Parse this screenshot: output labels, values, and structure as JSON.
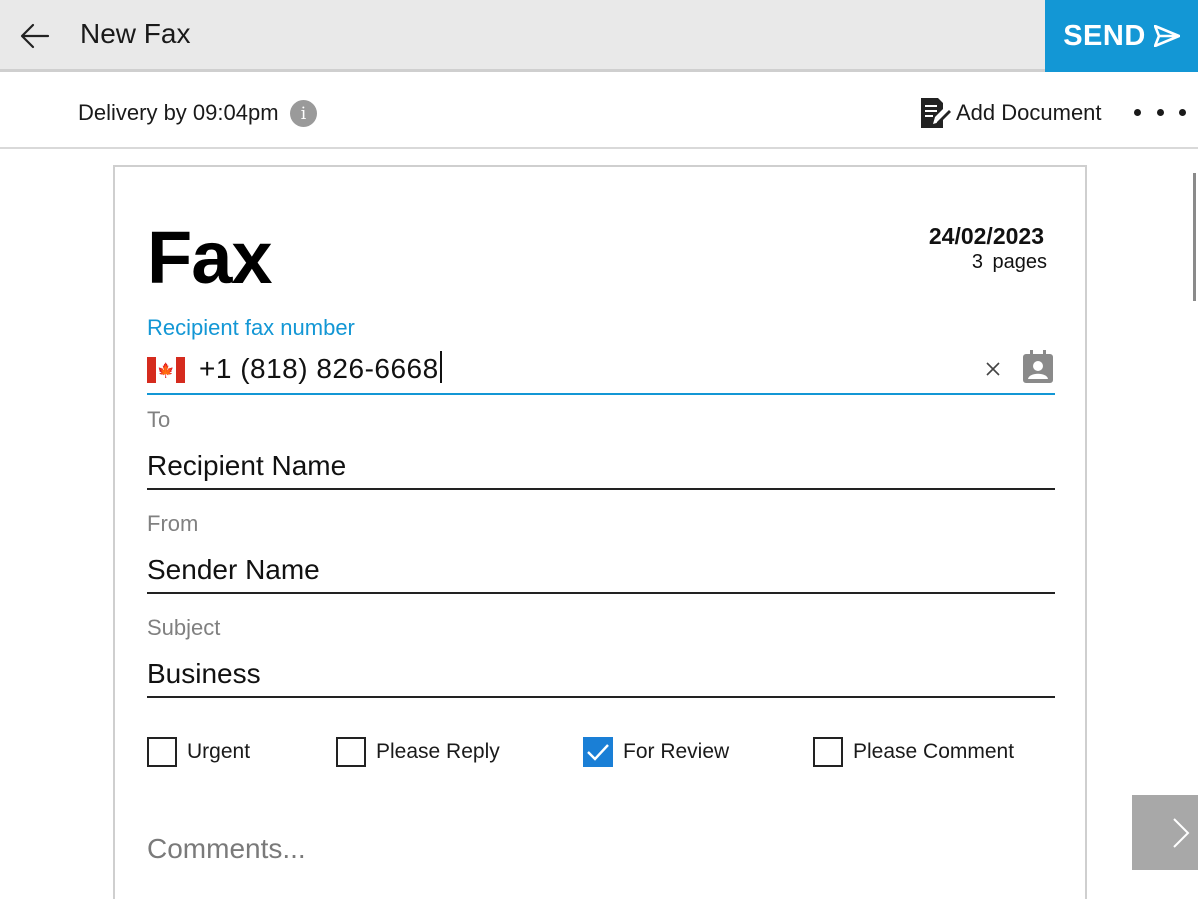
{
  "header": {
    "title": "New Fax",
    "send_label": "SEND"
  },
  "toolbar": {
    "delivery_text": "Delivery by 09:04pm",
    "info_glyph": "i",
    "add_document_label": "Add Document"
  },
  "document": {
    "heading": "Fax",
    "date": "24/02/2023",
    "pages": "3 pages",
    "recipient_fax": {
      "label": "Recipient fax number",
      "value": "+1 (818) 826-6668",
      "country_icon": "canada-flag-icon"
    },
    "to": {
      "label": "To",
      "value": "Recipient Name"
    },
    "from": {
      "label": "From",
      "value": "Sender Name"
    },
    "subject": {
      "label": "Subject",
      "value": "Business"
    },
    "checkboxes": [
      {
        "label": "Urgent",
        "checked": false
      },
      {
        "label": "Please Reply",
        "checked": false
      },
      {
        "label": "For Review",
        "checked": true
      },
      {
        "label": "Please Comment",
        "checked": false
      }
    ],
    "comments_placeholder": "Comments..."
  },
  "colors": {
    "accent": "#1397d5",
    "titlebar_bg": "#e9e9e9",
    "checkbox_checked": "#1a7fd6",
    "next_button_bg": "#a8a8a8"
  }
}
